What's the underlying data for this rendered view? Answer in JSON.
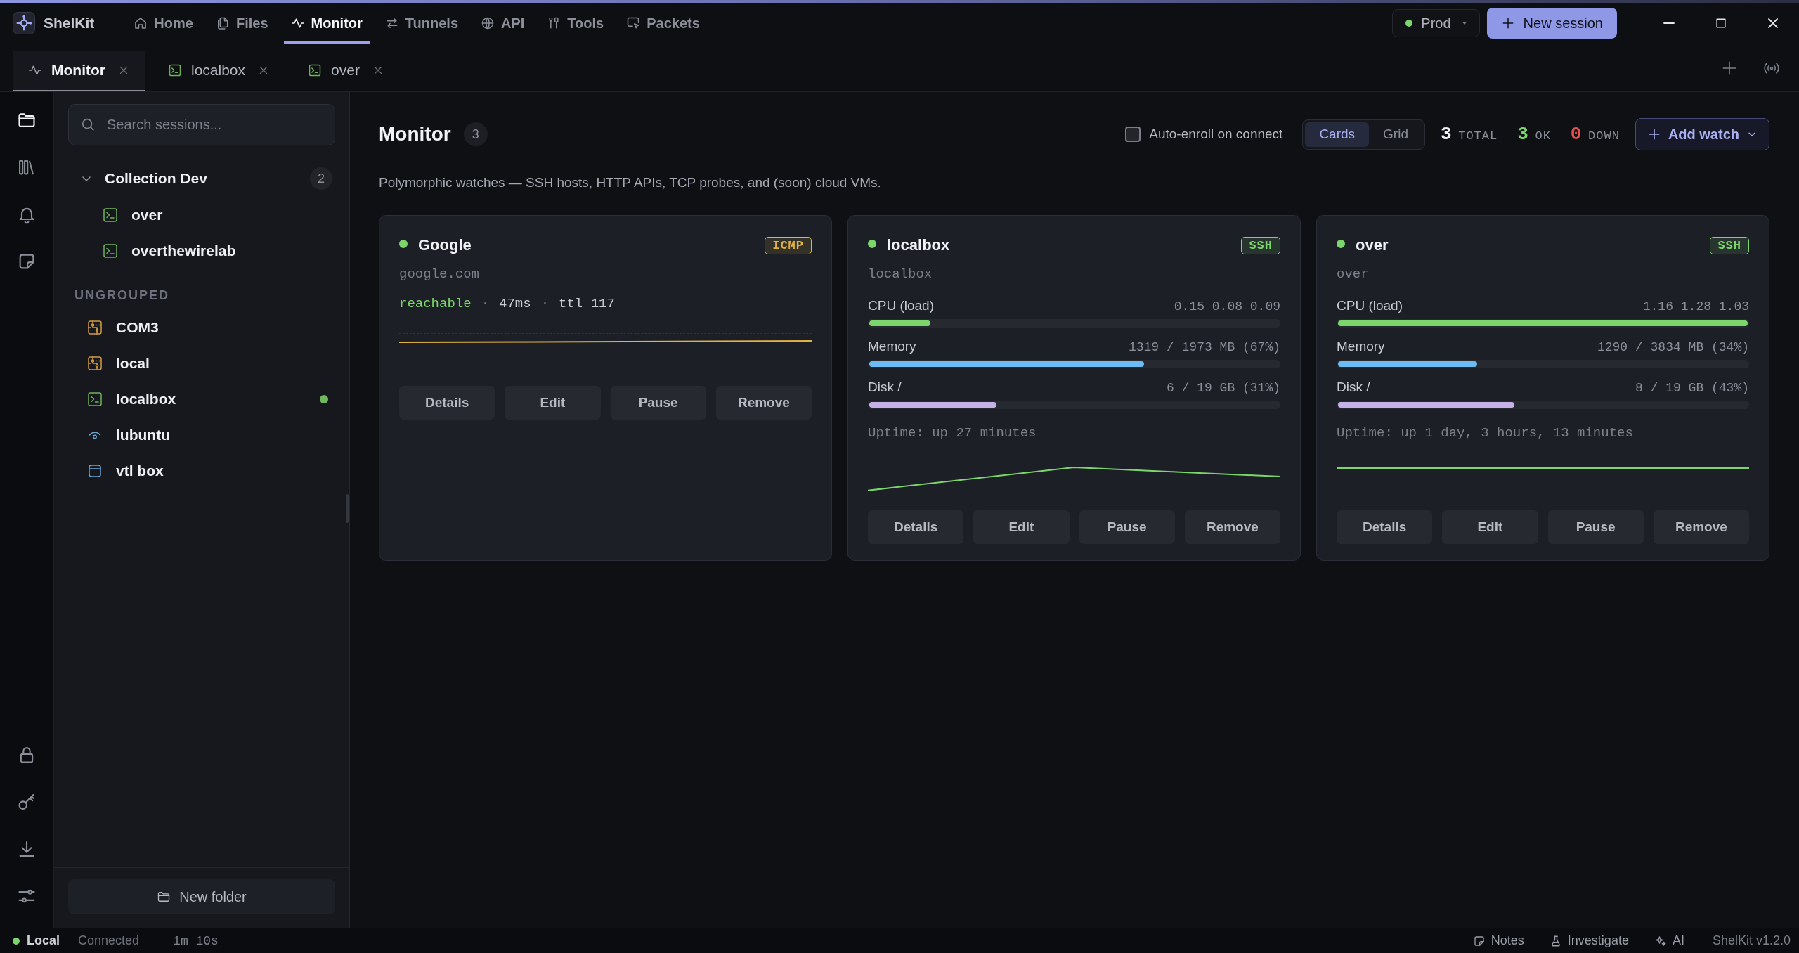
{
  "app": {
    "name": "ShelKit"
  },
  "nav": [
    {
      "label": "Home",
      "selected": false
    },
    {
      "label": "Files",
      "selected": false
    },
    {
      "label": "Monitor",
      "selected": true
    },
    {
      "label": "Tunnels",
      "selected": false
    },
    {
      "label": "API",
      "selected": false
    },
    {
      "label": "Tools",
      "selected": false
    },
    {
      "label": "Packets",
      "selected": false
    }
  ],
  "environment": {
    "label": "Prod",
    "online": true
  },
  "new_session_button": "New session",
  "tabs": [
    {
      "label": "Monitor",
      "kind": "monitor",
      "selected": true
    },
    {
      "label": "localbox",
      "kind": "ssh",
      "selected": false
    },
    {
      "label": "over",
      "kind": "ssh",
      "selected": false
    }
  ],
  "activity_bar": [
    {
      "selected": true
    },
    {
      "selected": false
    },
    {
      "selected": false
    },
    {
      "selected": false
    }
  ],
  "sidebar": {
    "search": {
      "placeholder": "Search sessions..."
    },
    "groups": [
      {
        "name": "Collection Dev",
        "count": "2",
        "expanded": true,
        "items": [
          {
            "label": "over",
            "kind": "ssh",
            "connected": false
          },
          {
            "label": "overthewirelab",
            "kind": "ssh",
            "connected": false
          }
        ]
      }
    ],
    "ungrouped_label": "UNGROUPED",
    "ungrouped": [
      {
        "label": "COM3",
        "kind": "serial",
        "connected": false
      },
      {
        "label": "local",
        "kind": "serial",
        "connected": false
      },
      {
        "label": "localbox",
        "kind": "ssh",
        "connected": true
      },
      {
        "label": "lubuntu",
        "kind": "vnc",
        "connected": false
      },
      {
        "label": "vtl box",
        "kind": "desktop",
        "connected": false
      }
    ],
    "new_folder_button": "New folder"
  },
  "header": {
    "title": "Monitor",
    "count": "3",
    "auto_enroll": {
      "label": "Auto-enroll on connect",
      "checked": false
    },
    "views": [
      {
        "label": "Cards",
        "selected": true
      },
      {
        "label": "Grid",
        "selected": false
      }
    ],
    "stats": [
      {
        "count": "3",
        "caption": "TOTAL",
        "kind": "total"
      },
      {
        "count": "3",
        "caption": "OK",
        "kind": "ok"
      },
      {
        "count": "0",
        "caption": "DOWN",
        "kind": "down"
      }
    ],
    "add_button": "Add watch",
    "description": "Polymorphic watches — SSH hosts, HTTP APIs, TCP probes, and (soon) cloud VMs."
  },
  "cards": [
    {
      "kind": "icmp",
      "name": "Google",
      "online": true,
      "protocol": {
        "label": "ICMP",
        "color": "#e3b341"
      },
      "host": "google.com",
      "probe": [
        {
          "text": "reachable",
          "kind": "status"
        },
        {
          "text": "·",
          "kind": "separator"
        },
        {
          "text": "47ms",
          "kind": "value"
        },
        {
          "text": "·",
          "kind": "separator"
        },
        {
          "text": "ttl 117",
          "kind": "value"
        }
      ],
      "actions": [
        "Details",
        "Edit",
        "Pause",
        "Remove"
      ]
    },
    {
      "kind": "ssh",
      "name": "localbox",
      "online": true,
      "protocol": {
        "label": "SSH",
        "color": "#7bd66b"
      },
      "host": "localbox",
      "metrics": [
        {
          "label": "CPU (load)",
          "reading": "0.15 0.08 0.09",
          "level": 0.15,
          "color": "#7bd66b"
        },
        {
          "label": "Memory",
          "reading": "1319 / 1973 MB (67%)",
          "level": 0.67,
          "color": "#6cbcf3"
        },
        {
          "label": "Disk /",
          "reading": "6 / 19 GB (31%)",
          "level": 0.31,
          "color": "#c5b0e8"
        }
      ],
      "uptime": "Uptime: up 27 minutes",
      "actions": [
        "Details",
        "Edit",
        "Pause",
        "Remove"
      ]
    },
    {
      "kind": "ssh",
      "name": "over",
      "online": true,
      "protocol": {
        "label": "SSH",
        "color": "#7bd66b"
      },
      "host": "over",
      "metrics": [
        {
          "label": "CPU (load)",
          "reading": "1.16 1.28 1.03",
          "level": 1.0,
          "color": "#7bd66b"
        },
        {
          "label": "Memory",
          "reading": "1290 / 3834 MB (34%)",
          "level": 0.34,
          "color": "#6cbcf3"
        },
        {
          "label": "Disk /",
          "reading": "8 / 19 GB (43%)",
          "level": 0.43,
          "color": "#c5b0e8"
        }
      ],
      "uptime": "Uptime: up 1 day, 3 hours, 13 minutes",
      "actions": [
        "Details",
        "Edit",
        "Pause",
        "Remove"
      ]
    }
  ],
  "status_bar": {
    "connection": {
      "label": "Local",
      "connected": true
    },
    "state": "Connected",
    "session_time": "1m 10s",
    "actions": [
      "Notes",
      "Investigate",
      "AI"
    ],
    "version": "ShelKit v1.2.0"
  }
}
